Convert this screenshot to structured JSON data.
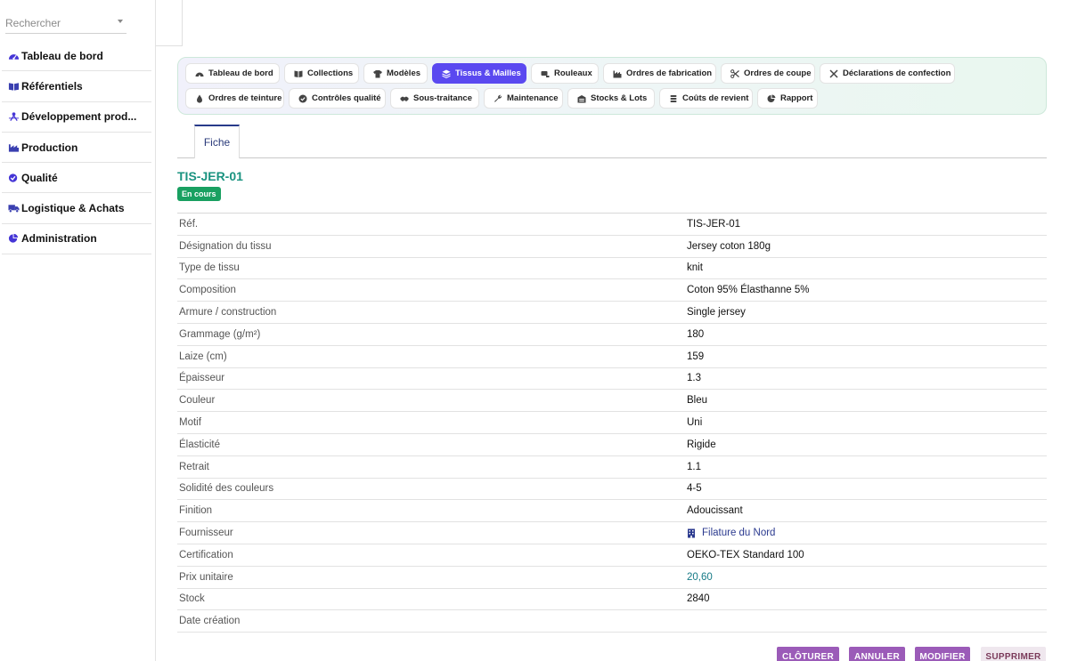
{
  "search": {
    "placeholder": "Rechercher"
  },
  "sidebar": {
    "items": [
      {
        "label": "Tableau de bord",
        "icon": "gauge-icon"
      },
      {
        "label": "Référentiels",
        "icon": "book-icon"
      },
      {
        "label": "Développement prod...",
        "icon": "designer-icon"
      },
      {
        "label": "Production",
        "icon": "factory-icon"
      },
      {
        "label": "Qualité",
        "icon": "check-circle-icon"
      },
      {
        "label": "Logistique & Achats",
        "icon": "truck-icon"
      },
      {
        "label": "Administration",
        "icon": "pie-chart-icon"
      }
    ]
  },
  "modules": {
    "tabs": [
      {
        "label": "Tableau de bord",
        "icon": "gauge-icon"
      },
      {
        "label": "Collections",
        "icon": "book-icon"
      },
      {
        "label": "Modèles",
        "icon": "shirt-icon"
      },
      {
        "label": "Tissus & Mailles",
        "icon": "layers-icon"
      },
      {
        "label": "Rouleaux",
        "icon": "roll-icon"
      },
      {
        "label": "Ordres de fabrication",
        "icon": "factory-icon"
      },
      {
        "label": "Ordres de coupe",
        "icon": "scissors-icon"
      },
      {
        "label": "Déclarations de confection",
        "icon": "tools-icon"
      },
      {
        "label": "Ordres de teinture",
        "icon": "drop-icon"
      },
      {
        "label": "Contrôles qualité",
        "icon": "check-circle-icon"
      },
      {
        "label": "Sous-traitance",
        "icon": "handshake-icon"
      },
      {
        "label": "Maintenance",
        "icon": "wrench-icon"
      },
      {
        "label": "Stocks & Lots",
        "icon": "warehouse-icon"
      },
      {
        "label": "Coûts de revient",
        "icon": "coins-icon"
      },
      {
        "label": "Rapport",
        "icon": "pie-chart-icon"
      }
    ],
    "active_index": 3
  },
  "subtabs": {
    "fiche": "Fiche"
  },
  "record": {
    "title": "TIS-JER-01",
    "status": "En cours",
    "fields": [
      {
        "label": "Réf.",
        "value": "TIS-JER-01"
      },
      {
        "label": "Désignation du tissu",
        "value": "Jersey coton 180g"
      },
      {
        "label": "Type de tissu",
        "value": "knit"
      },
      {
        "label": "Composition",
        "value": "Coton 95% Élasthanne 5%"
      },
      {
        "label": "Armure / construction",
        "value": "Single jersey"
      },
      {
        "label": "Grammage (g/m²)",
        "value": "180"
      },
      {
        "label": "Laize (cm)",
        "value": "159"
      },
      {
        "label": "Épaisseur",
        "value": "1.3"
      },
      {
        "label": "Couleur",
        "value": "Bleu"
      },
      {
        "label": "Motif",
        "value": "Uni"
      },
      {
        "label": "Élasticité",
        "value": "Rigide"
      },
      {
        "label": "Retrait",
        "value": "1.1"
      },
      {
        "label": "Solidité des couleurs",
        "value": "4-5"
      },
      {
        "label": "Finition",
        "value": "Adoucissant"
      },
      {
        "label": "Fournisseur",
        "value": "Filature du Nord"
      },
      {
        "label": "Certification",
        "value": "OEKO-TEX Standard 100"
      },
      {
        "label": "Prix unitaire",
        "value": "20,60"
      },
      {
        "label": "Stock",
        "value": "2840"
      },
      {
        "label": "Date création",
        "value": ""
      }
    ]
  },
  "actions": {
    "cloturer": "CLÔTURER",
    "annuler": "ANNULER",
    "modifier": "MODIFIER",
    "supprimer": "SUPPRIMER"
  },
  "colors": {
    "accent": "#5a49f0",
    "title": "#1a9380",
    "badge": "#19a061",
    "action": "#9b5bb8"
  }
}
